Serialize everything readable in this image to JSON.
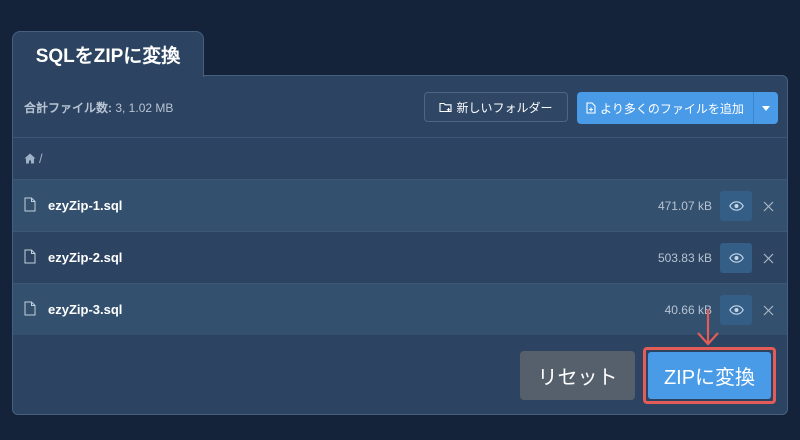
{
  "tab": {
    "title": "SQLをZIPに変換"
  },
  "toolbar": {
    "file_count_label": "合計ファイル数:",
    "file_count_value": "3, 1.02 MB",
    "new_folder_label": "新しいフォルダー",
    "add_files_label": "より多くのファイルを追加"
  },
  "breadcrumb": {
    "separator": "/"
  },
  "files": [
    {
      "name": "ezyZip-1.sql",
      "size": "471.07 kB"
    },
    {
      "name": "ezyZip-2.sql",
      "size": "503.83 kB"
    },
    {
      "name": "ezyZip-3.sql",
      "size": "40.66 kB"
    }
  ],
  "actions": {
    "reset_label": "リセット",
    "convert_label": "ZIPに変換"
  },
  "colors": {
    "accent": "#4a9be7",
    "highlight": "#e35c57",
    "panel": "#2c4461",
    "background": "#14233a"
  },
  "icons": [
    "folder-plus-icon",
    "file-plus-icon",
    "chevron-down-icon",
    "home-icon",
    "file-icon",
    "eye-icon",
    "close-icon",
    "arrow-down-icon"
  ]
}
